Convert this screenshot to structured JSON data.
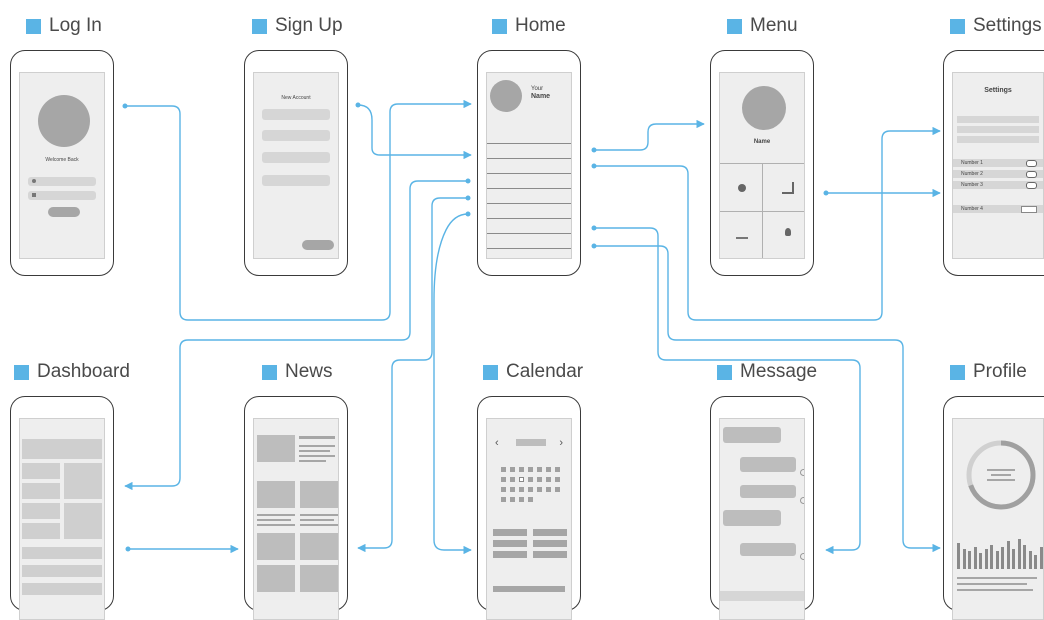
{
  "screens": {
    "login": "Log In",
    "signup": "Sign Up",
    "home": "Home",
    "menu": "Menu",
    "settings": "Settings",
    "dashboard": "Dashboard",
    "news": "News",
    "calendar": "Calendar",
    "message": "Message",
    "profile": "Profile"
  },
  "login_screen": {
    "welcome": "Welcome Back"
  },
  "signup_screen": {
    "heading": "New Account"
  },
  "home_screen": {
    "your": "Your",
    "name": "Name"
  },
  "menu_screen": {
    "name": "Name"
  },
  "settings_screen": {
    "title": "Settings",
    "options": [
      "Number 1",
      "Number 2",
      "Number 3",
      "Number 4"
    ]
  },
  "colors": {
    "accent": "#5ab4e5",
    "outline": "#3a3a3a",
    "placeholder": "#bdbdbd"
  }
}
